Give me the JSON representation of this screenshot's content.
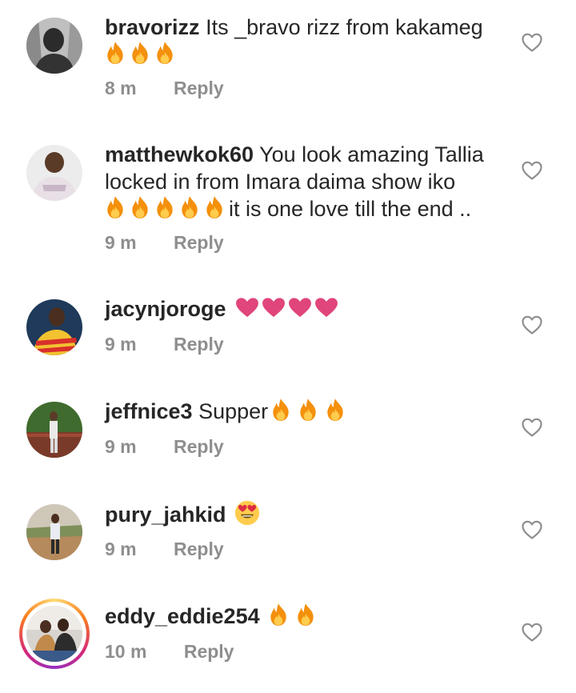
{
  "comments": [
    {
      "username": "bravorizz",
      "text": "Its _bravo rizz from kakameg",
      "emoji_line": [
        "fire",
        "fire",
        "fire"
      ],
      "time": "8 m",
      "reply": "Reply"
    },
    {
      "username": "matthewkok60",
      "text_line1": "You look amazing Tallia",
      "text_line2": "locked in from Imara daima show iko",
      "emoji_line": [
        "fire",
        "fire",
        "fire",
        "fire",
        "fire"
      ],
      "text_line3": "it is one love till the end ..",
      "time": "9 m",
      "reply": "Reply"
    },
    {
      "username": "jacynjoroge",
      "emojis": [
        "pink-heart",
        "pink-heart",
        "pink-heart",
        "pink-heart"
      ],
      "time": "9 m",
      "reply": "Reply"
    },
    {
      "username": "jeffnice3",
      "text": "Supper",
      "emojis": [
        "fire",
        "fire",
        "fire"
      ],
      "time": "9 m",
      "reply": "Reply"
    },
    {
      "username": "pury_jahkid",
      "emojis": [
        "heart-eyes-face"
      ],
      "time": "9 m",
      "reply": "Reply"
    },
    {
      "username": "eddy_eddie254",
      "emojis": [
        "fire",
        "fire"
      ],
      "time": "10 m",
      "reply": "Reply"
    }
  ],
  "icons": {
    "like": "heart-outline-icon"
  },
  "colors": {
    "text": "#262626",
    "meta": "#8e8e8e",
    "like_outline": "#8e8e8e",
    "heart_emoji": "#e0457b",
    "fire_outer": "#f4900c",
    "fire_inner": "#ffcc4d"
  }
}
